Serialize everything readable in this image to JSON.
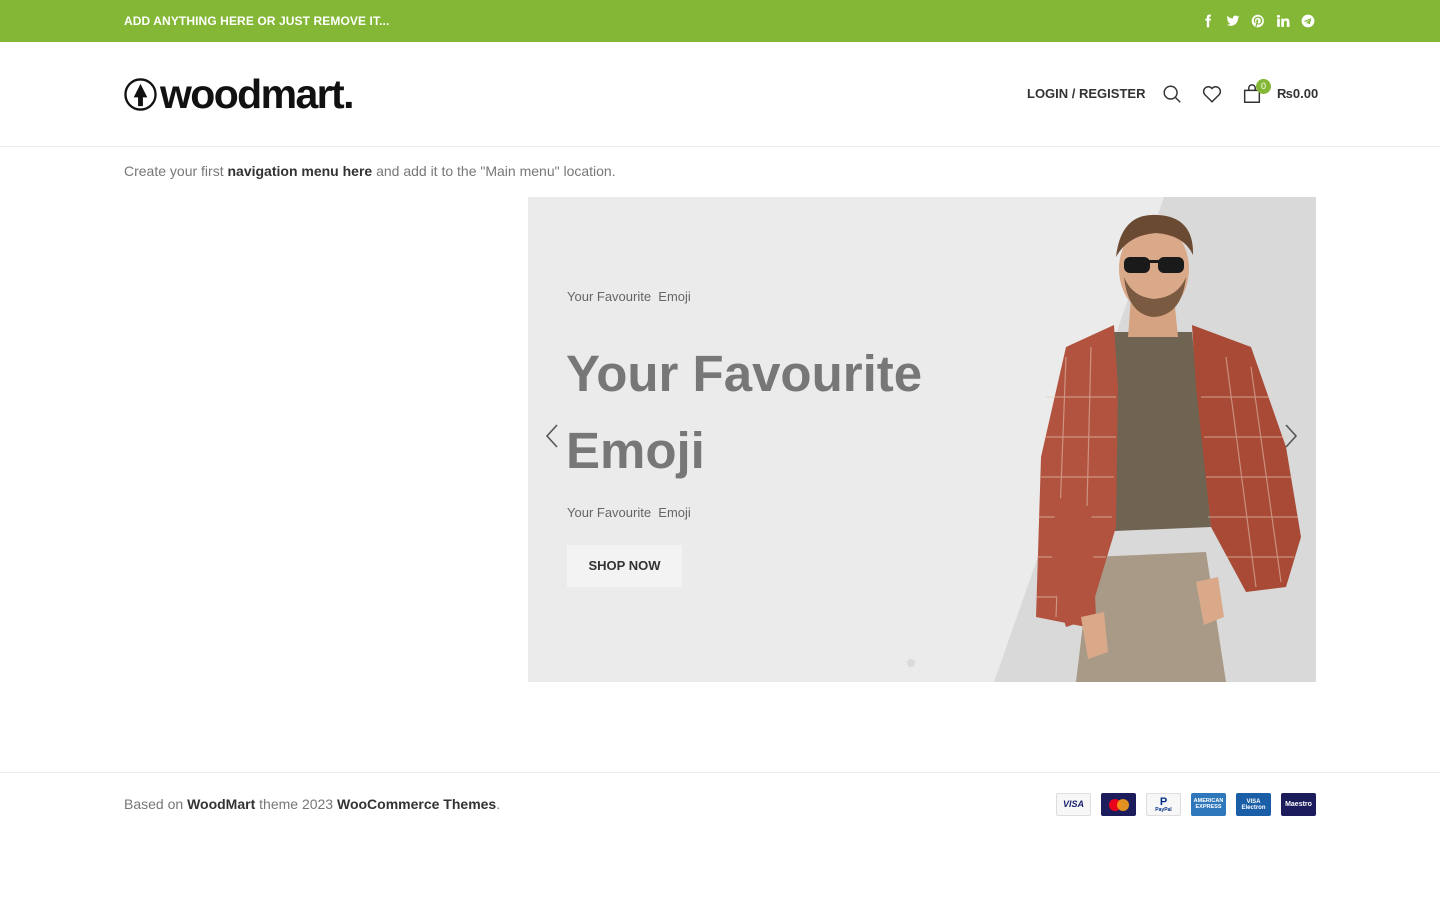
{
  "topbar": {
    "text": "ADD ANYTHING HERE OR JUST REMOVE IT...",
    "social_icons": [
      "facebook-icon",
      "twitter-icon",
      "pinterest-icon",
      "linkedin-icon",
      "telegram-icon"
    ]
  },
  "header": {
    "logo_text": "woodmart.",
    "login_label": "LOGIN / REGISTER",
    "cart_count": "0",
    "cart_total": "₨0.00",
    "icons": [
      "search-icon",
      "wishlist-heart-icon",
      "cart-bag-icon"
    ]
  },
  "nav_note": {
    "prefix": "Create your first",
    "link": "navigation menu here",
    "suffix": "and add it to the \"Main menu\" location."
  },
  "slider": {
    "subtitle": "Your Favourite  Emoji",
    "title": "Your Favourite Emoji",
    "text": "Your Favourite  Emoji",
    "button_label": "SHOP NOW"
  },
  "footer": {
    "prefix": "Based on",
    "brand": "WoodMart",
    "middle": "theme 2023",
    "company": "WooCommerce Themes",
    "suffix": ".",
    "payments": [
      "VISA",
      "MasterCard",
      "PayPal",
      "AMERICAN EXPRESS",
      "VISA Electron",
      "Maestro"
    ]
  },
  "colors": {
    "accent": "#83b735",
    "slider_bg": "#ebebeb",
    "text": "#777777",
    "heading": "#333333"
  }
}
